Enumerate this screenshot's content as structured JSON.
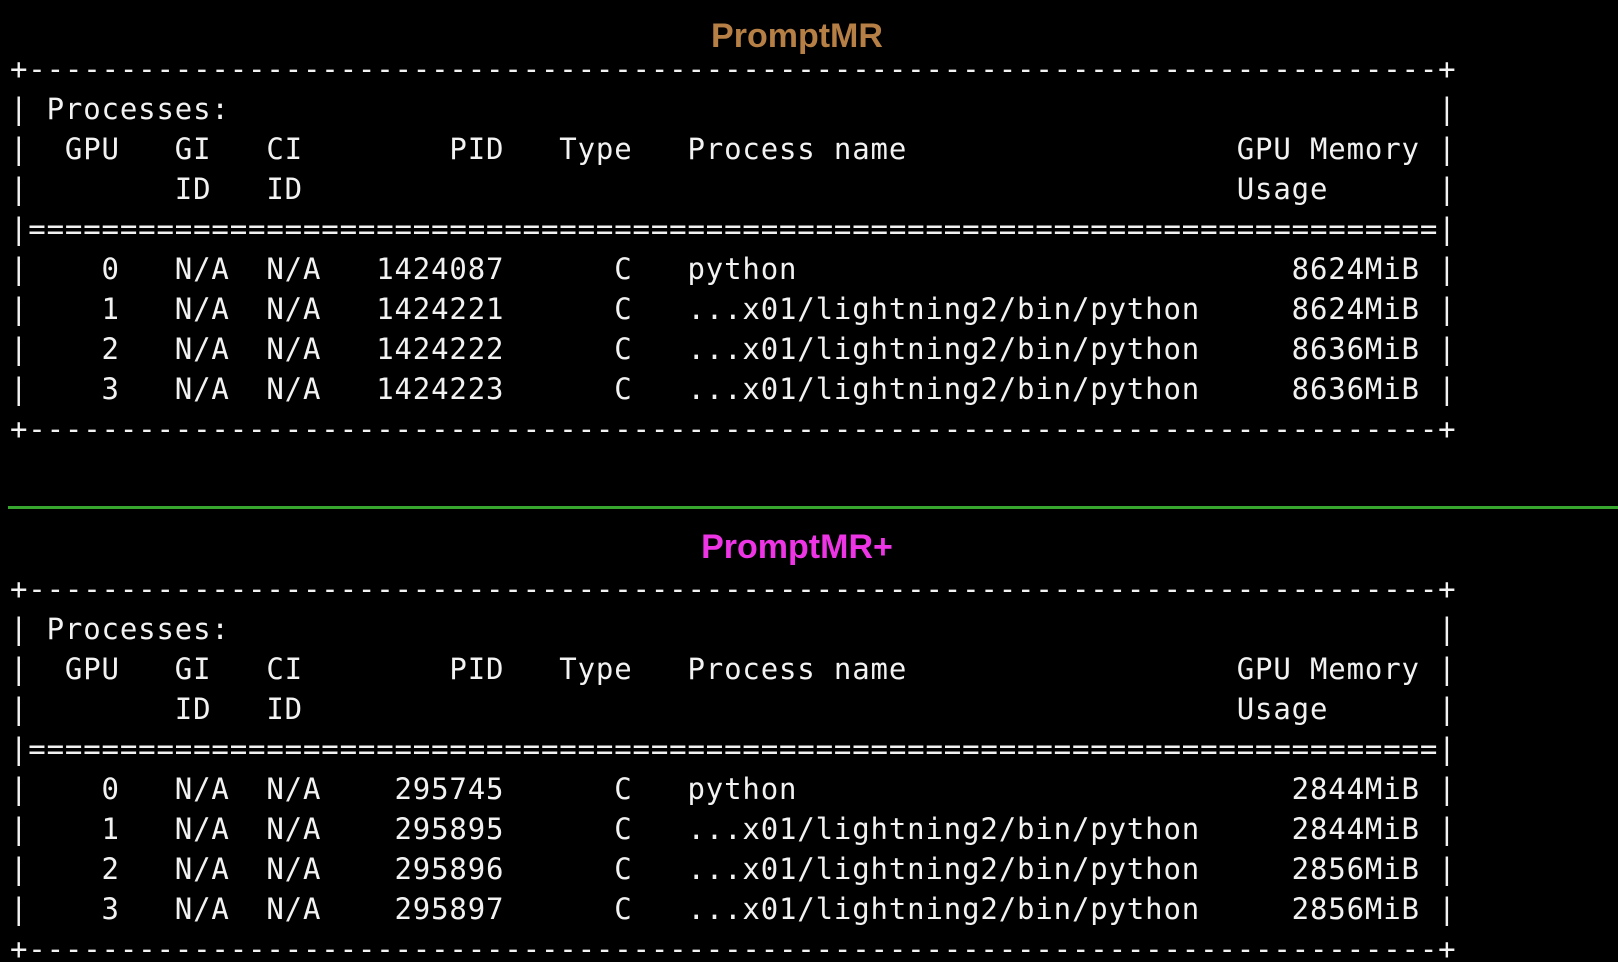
{
  "sections": [
    {
      "title": "PromptMR",
      "title_color": "#b57f45",
      "lines": [
        "+-----------------------------------------------------------------------------+",
        "| Processes:                                                                  |",
        "|  GPU   GI   CI        PID   Type   Process name                  GPU Memory |",
        "|        ID   ID                                                   Usage      |",
        "|=============================================================================|",
        "|    0   N/A  N/A   1424087      C   python                           8624MiB |",
        "|    1   N/A  N/A   1424221      C   ...x01/lightning2/bin/python     8624MiB |",
        "|    2   N/A  N/A   1424222      C   ...x01/lightning2/bin/python     8636MiB |",
        "|    3   N/A  N/A   1424223      C   ...x01/lightning2/bin/python     8636MiB |",
        "+-----------------------------------------------------------------------------+"
      ]
    },
    {
      "title": "PromptMR+",
      "title_color": "#ee35e6",
      "lines": [
        "+-----------------------------------------------------------------------------+",
        "| Processes:                                                                  |",
        "|  GPU   GI   CI        PID   Type   Process name                  GPU Memory |",
        "|        ID   ID                                                   Usage      |",
        "|=============================================================================|",
        "|    0   N/A  N/A    295745      C   python                           2844MiB |",
        "|    1   N/A  N/A    295895      C   ...x01/lightning2/bin/python     2844MiB |",
        "|    2   N/A  N/A    295896      C   ...x01/lightning2/bin/python     2856MiB |",
        "|    3   N/A  N/A    295897      C   ...x01/lightning2/bin/python     2856MiB |",
        "+-----------------------------------------------------------------------------+"
      ]
    }
  ],
  "colors": {
    "background": "#000000",
    "terminal_text": "#f2f2f2",
    "divider": "#37a62e"
  }
}
